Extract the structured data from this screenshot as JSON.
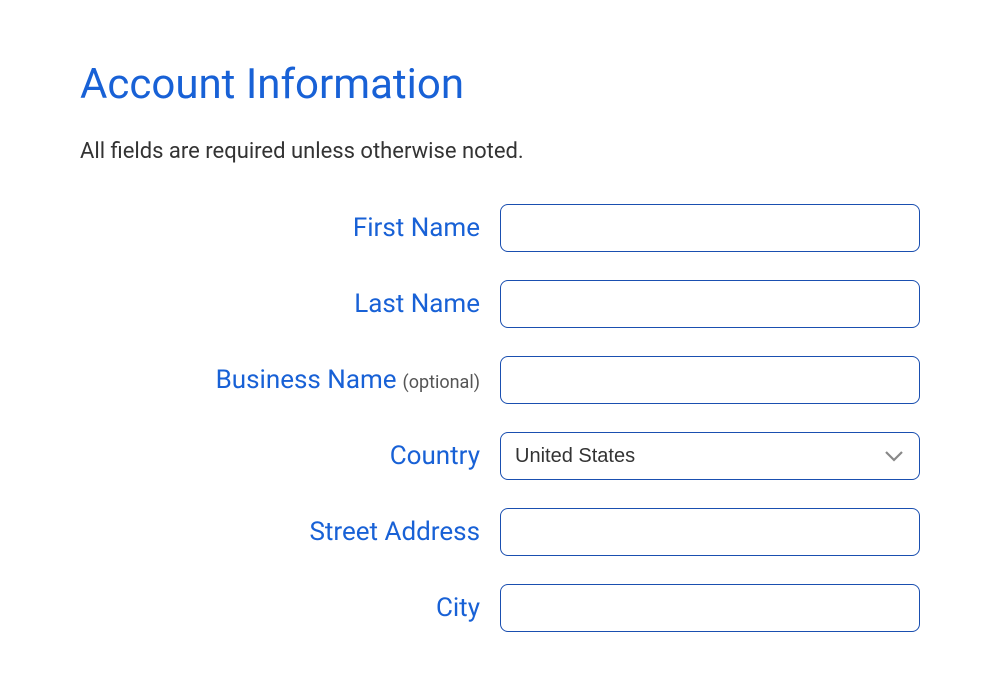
{
  "header": {
    "title": "Account Information",
    "subtitle": "All fields are required unless otherwise noted."
  },
  "form": {
    "first_name": {
      "label": "First Name",
      "value": ""
    },
    "last_name": {
      "label": "Last Name",
      "value": ""
    },
    "business_name": {
      "label": "Business Name",
      "hint": "(optional)",
      "value": ""
    },
    "country": {
      "label": "Country",
      "selected": "United States"
    },
    "street_address": {
      "label": "Street Address",
      "value": ""
    },
    "city": {
      "label": "City",
      "value": ""
    }
  }
}
